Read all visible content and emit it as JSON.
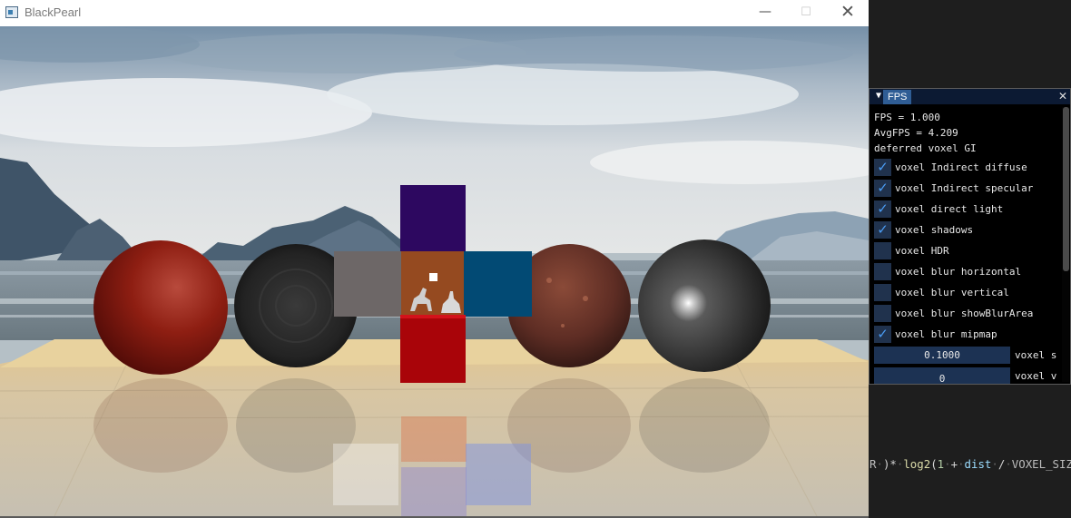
{
  "window": {
    "title": "BlackPearl",
    "icon": "app-window-icon",
    "minimize_glyph": "—",
    "maximize_glyph": "☐",
    "close_glyph": "✕"
  },
  "fps_panel": {
    "tab_label": "FPS",
    "collapse_glyph": "▼",
    "close_glyph": "✕",
    "fps_text": "FPS = 1.000",
    "avg_fps_text": "AvgFPS = 4.209",
    "mode_text": "deferred voxel GI",
    "checkboxes": [
      {
        "label": "voxel Indirect diffuse",
        "checked": true
      },
      {
        "label": "voxel Indirect specular",
        "checked": true
      },
      {
        "label": "voxel direct light",
        "checked": true
      },
      {
        "label": "voxel shadows",
        "checked": true
      },
      {
        "label": "voxel HDR",
        "checked": false
      },
      {
        "label": "voxel blur horizontal",
        "checked": false
      },
      {
        "label": "voxel blur vertical",
        "checked": false
      },
      {
        "label": "voxel blur showBlurArea",
        "checked": false
      },
      {
        "label": "voxel blur mipmap",
        "checked": true
      }
    ],
    "check_glyph": "✓",
    "sliders": [
      {
        "value": "0.1000",
        "label": "voxel s"
      },
      {
        "value": "0",
        "label": "voxel v"
      }
    ]
  },
  "code_fragment": {
    "part1": "R",
    "part2": ")",
    "part3": "*",
    "part4": "log2",
    "part5": "(",
    "part6": "1",
    "part7": "+",
    "part8": "dist",
    "part9": "/",
    "part10": "VOXEL_SIZE"
  },
  "colors": {
    "accent_blue": "#2f5d95",
    "checkmark": "#4a9bf1",
    "cube_top": "#2d0860",
    "cube_left": "#6d6767",
    "cube_center": "#a4511c",
    "cube_right": "#024a74",
    "cube_bottom": "#a90409"
  }
}
